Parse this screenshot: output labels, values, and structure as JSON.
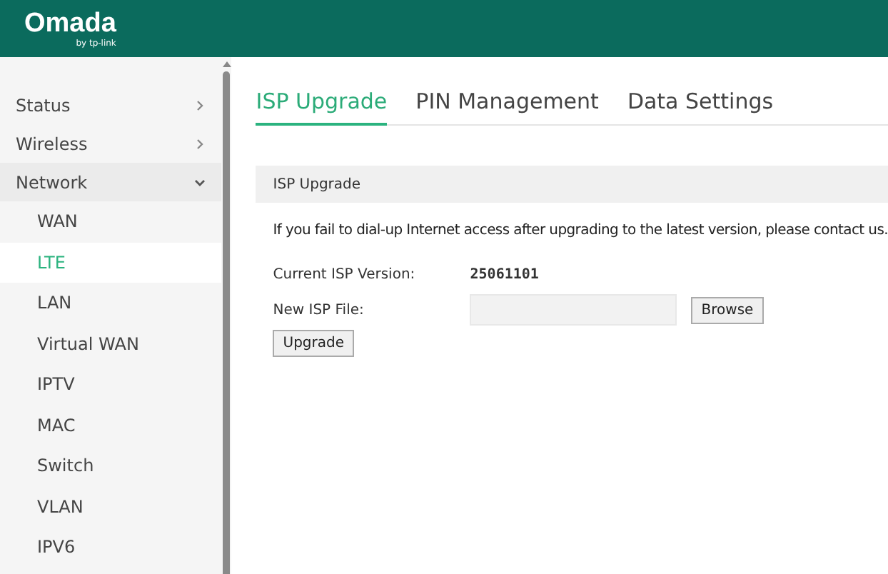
{
  "header": {
    "logo": "Omada",
    "logo_sub": "by tp-link"
  },
  "sidebar": {
    "items": [
      {
        "label": "Status",
        "expanded": false
      },
      {
        "label": "Wireless",
        "expanded": false
      },
      {
        "label": "Network",
        "expanded": true,
        "children": [
          {
            "label": "WAN",
            "selected": false
          },
          {
            "label": "LTE",
            "selected": true
          },
          {
            "label": "LAN",
            "selected": false
          },
          {
            "label": "Virtual WAN",
            "selected": false
          },
          {
            "label": "IPTV",
            "selected": false
          },
          {
            "label": "MAC",
            "selected": false
          },
          {
            "label": "Switch",
            "selected": false
          },
          {
            "label": "VLAN",
            "selected": false
          },
          {
            "label": "IPV6",
            "selected": false
          }
        ]
      }
    ]
  },
  "tabs": [
    {
      "label": "ISP Upgrade",
      "selected": true
    },
    {
      "label": "PIN Management",
      "selected": false
    },
    {
      "label": "Data Settings",
      "selected": false
    }
  ],
  "section": {
    "title": "ISP Upgrade",
    "notice": "If you fail to dial-up Internet access after upgrading to the latest version, please contact us.",
    "current_version_label": "Current ISP Version:",
    "current_version": "25061101",
    "file_label": "New ISP File:",
    "browse_button": "Browse",
    "upgrade_button": "Upgrade"
  }
}
